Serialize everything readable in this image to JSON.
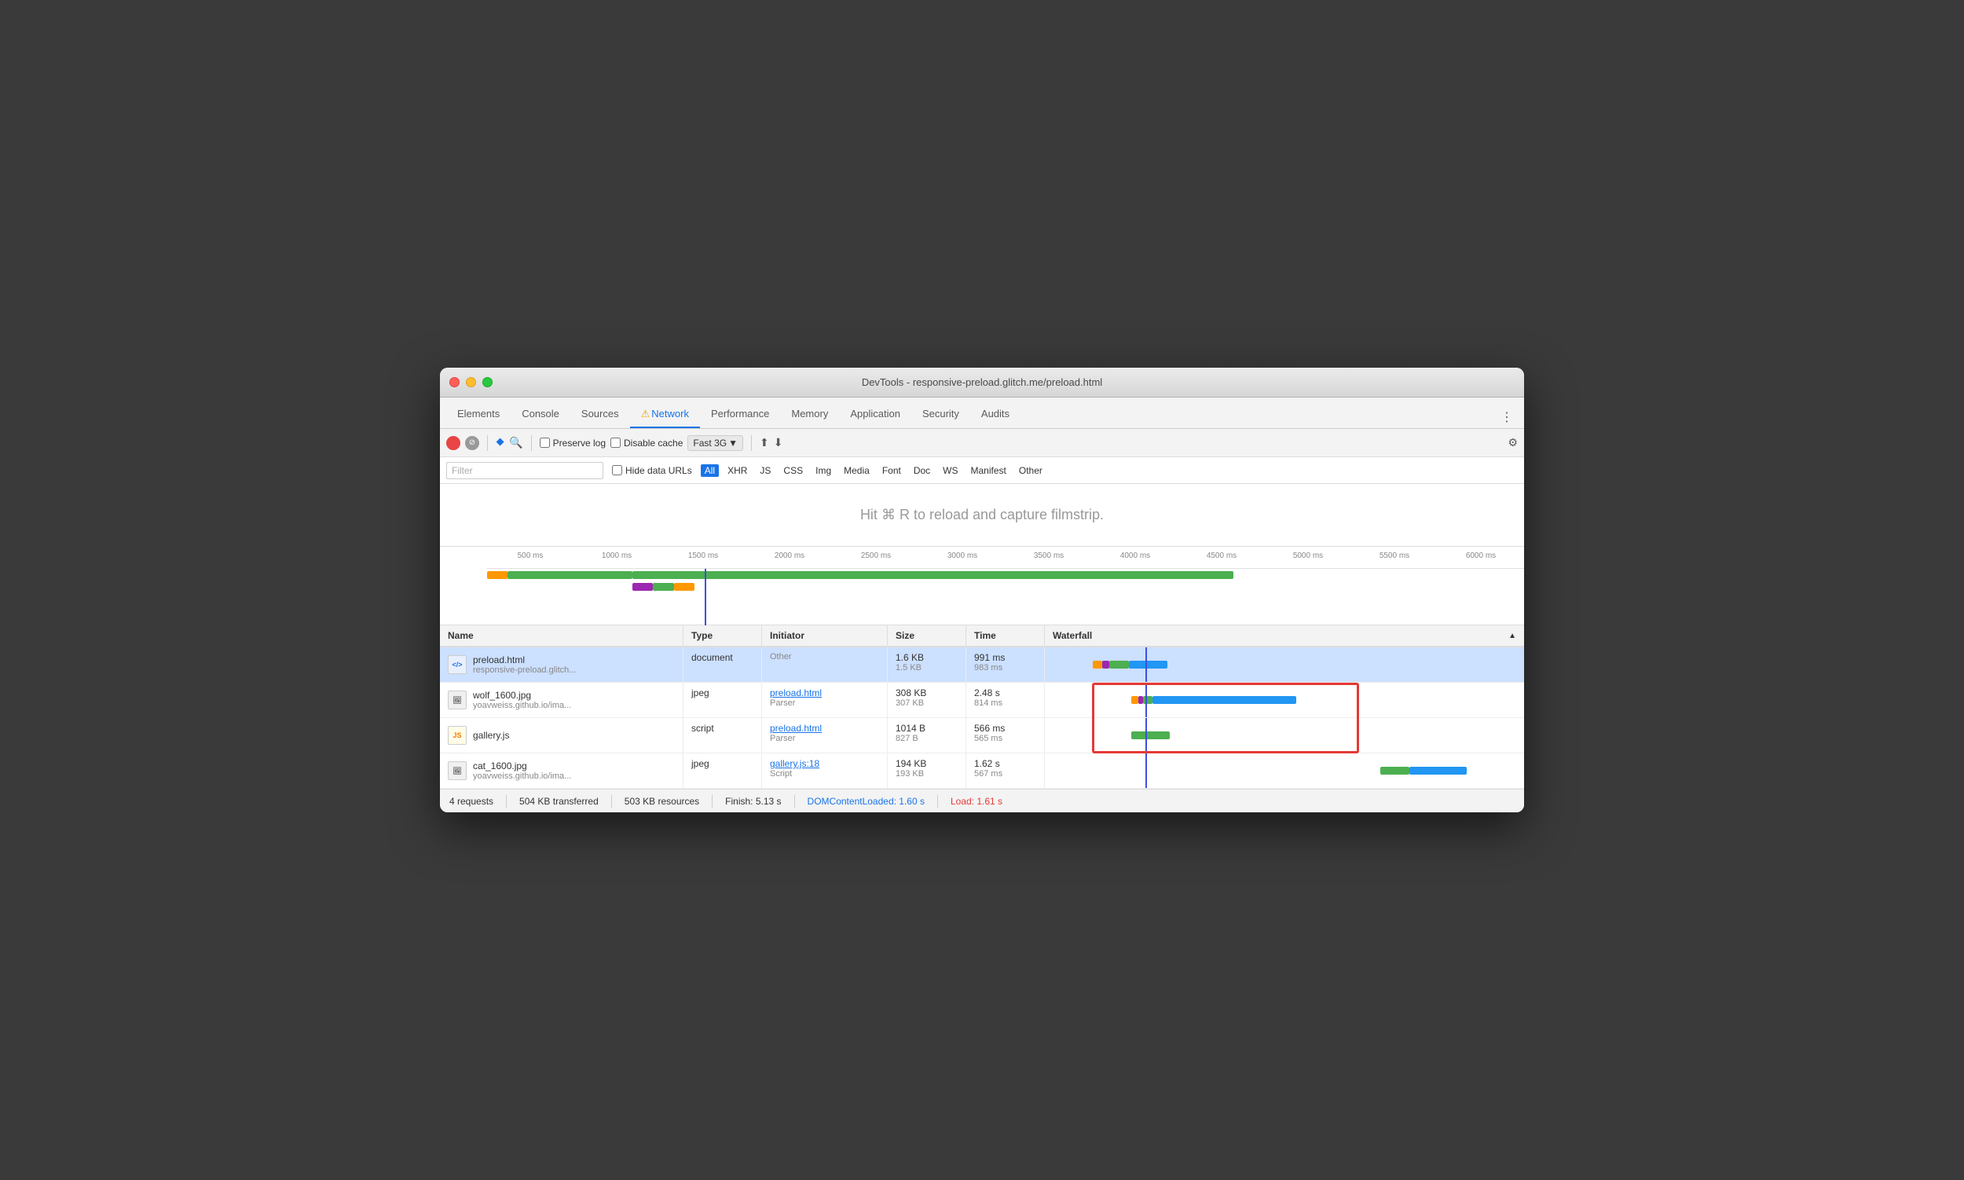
{
  "window": {
    "title": "DevTools - responsive-preload.glitch.me/preload.html"
  },
  "tabs": [
    {
      "label": "Elements",
      "active": false
    },
    {
      "label": "Console",
      "active": false
    },
    {
      "label": "Sources",
      "active": false
    },
    {
      "label": "Network",
      "active": true,
      "warn": true
    },
    {
      "label": "Performance",
      "active": false
    },
    {
      "label": "Memory",
      "active": false
    },
    {
      "label": "Application",
      "active": false
    },
    {
      "label": "Security",
      "active": false
    },
    {
      "label": "Audits",
      "active": false
    }
  ],
  "toolbar": {
    "preserve_log_label": "Preserve log",
    "disable_cache_label": "Disable cache",
    "throttle_label": "Fast 3G"
  },
  "filter_bar": {
    "placeholder": "Filter",
    "hide_data_urls_label": "Hide data URLs",
    "chips": [
      "All",
      "XHR",
      "JS",
      "CSS",
      "Img",
      "Media",
      "Font",
      "Doc",
      "WS",
      "Manifest",
      "Other"
    ]
  },
  "filmstrip": {
    "message": "Hit ⌘ R to reload and capture filmstrip."
  },
  "timeline": {
    "ticks": [
      "500 ms",
      "1000 ms",
      "1500 ms",
      "2000 ms",
      "2500 ms",
      "3000 ms",
      "3500 ms",
      "4000 ms",
      "4500 ms",
      "5000 ms",
      "5500 ms",
      "6000 ms"
    ]
  },
  "table": {
    "headers": [
      "Name",
      "Type",
      "Initiator",
      "Size",
      "Time",
      "Waterfall"
    ],
    "rows": [
      {
        "name": "preload.html",
        "name_sub": "responsive-preload.glitch...",
        "type": "document",
        "initiator": "Other",
        "initiator_link": null,
        "size_primary": "1.6 KB",
        "size_secondary": "1.5 KB",
        "time_primary": "991 ms",
        "time_secondary": "983 ms",
        "file_type": "html",
        "selected": true
      },
      {
        "name": "wolf_1600.jpg",
        "name_sub": "yoavweiss.github.io/ima...",
        "type": "jpeg",
        "initiator": "preload.html",
        "initiator_sub": "Parser",
        "initiator_link": true,
        "size_primary": "308 KB",
        "size_secondary": "307 KB",
        "time_primary": "2.48 s",
        "time_secondary": "814 ms",
        "file_type": "img",
        "selected": false
      },
      {
        "name": "gallery.js",
        "name_sub": "",
        "type": "script",
        "initiator": "preload.html",
        "initiator_sub": "Parser",
        "initiator_link": true,
        "size_primary": "1014 B",
        "size_secondary": "827 B",
        "time_primary": "566 ms",
        "time_secondary": "565 ms",
        "file_type": "js",
        "selected": false
      },
      {
        "name": "cat_1600.jpg",
        "name_sub": "yoavweiss.github.io/ima...",
        "type": "jpeg",
        "initiator": "gallery.js:18",
        "initiator_sub": "Script",
        "initiator_link": true,
        "size_primary": "194 KB",
        "size_secondary": "193 KB",
        "time_primary": "1.62 s",
        "time_secondary": "567 ms",
        "file_type": "img",
        "selected": false
      }
    ]
  },
  "status_bar": {
    "requests": "4 requests",
    "transferred": "504 KB transferred",
    "resources": "503 KB resources",
    "finish": "Finish: 5.13 s",
    "dom_loaded": "DOMContentLoaded: 1.60 s",
    "load": "Load: 1.61 s"
  }
}
